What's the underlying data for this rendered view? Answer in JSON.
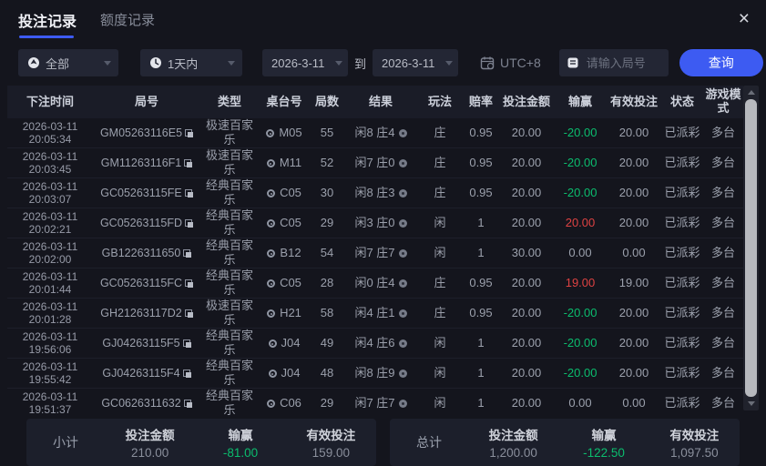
{
  "window": {
    "close_icon": "×"
  },
  "tabs": [
    {
      "label": "投注记录",
      "active": true
    },
    {
      "label": "额度记录",
      "active": false
    }
  ],
  "filters": {
    "category": {
      "value": "全部",
      "icon": "target-icon"
    },
    "range": {
      "value": "1天内",
      "icon": "clock-icon"
    },
    "date_from": "2026-3-11",
    "to_label": "到",
    "date_to": "2026-3-11",
    "timezone": "UTC+8",
    "timezone_icon": "calendar-icon",
    "search_placeholder": "请输入局号",
    "query_label": "查询"
  },
  "table": {
    "headers": [
      "下注时间",
      "局号",
      "类型",
      "桌台号",
      "局数",
      "结果",
      "玩法",
      "赔率",
      "投注金额",
      "输赢",
      "有效投注",
      "状态",
      "游戏模式"
    ],
    "rows": [
      {
        "date": "2026-03-11",
        "time": "20:05:34",
        "game_id": "GM05263116E5",
        "type": "极速百家乐",
        "table_no": "M05",
        "round": "55",
        "result": "闲8 庄4",
        "play": "庄",
        "odds": "0.95",
        "amount": "20.00",
        "win_loss": "-20.00",
        "win_loss_color": "green",
        "valid": "20.00",
        "status": "已派彩",
        "mode": "多台"
      },
      {
        "date": "2026-03-11",
        "time": "20:03:45",
        "game_id": "GM11263116F1",
        "type": "极速百家乐",
        "table_no": "M11",
        "round": "52",
        "result": "闲7 庄0",
        "play": "庄",
        "odds": "0.95",
        "amount": "20.00",
        "win_loss": "-20.00",
        "win_loss_color": "green",
        "valid": "20.00",
        "status": "已派彩",
        "mode": "多台"
      },
      {
        "date": "2026-03-11",
        "time": "20:03:07",
        "game_id": "GC05263115FE",
        "type": "经典百家乐",
        "table_no": "C05",
        "round": "30",
        "result": "闲8 庄3",
        "play": "庄",
        "odds": "0.95",
        "amount": "20.00",
        "win_loss": "-20.00",
        "win_loss_color": "green",
        "valid": "20.00",
        "status": "已派彩",
        "mode": "多台"
      },
      {
        "date": "2026-03-11",
        "time": "20:02:21",
        "game_id": "GC05263115FD",
        "type": "经典百家乐",
        "table_no": "C05",
        "round": "29",
        "result": "闲3 庄0",
        "play": "闲",
        "odds": "1",
        "amount": "20.00",
        "win_loss": "20.00",
        "win_loss_color": "red",
        "valid": "20.00",
        "status": "已派彩",
        "mode": "多台"
      },
      {
        "date": "2026-03-11",
        "time": "20:02:00",
        "game_id": "GB1226311650",
        "type": "经典百家乐",
        "table_no": "B12",
        "round": "54",
        "result": "闲7 庄7",
        "play": "闲",
        "odds": "1",
        "amount": "30.00",
        "win_loss": "0.00",
        "win_loss_color": "neutral",
        "valid": "0.00",
        "status": "已派彩",
        "mode": "多台"
      },
      {
        "date": "2026-03-11",
        "time": "20:01:44",
        "game_id": "GC05263115FC",
        "type": "经典百家乐",
        "table_no": "C05",
        "round": "28",
        "result": "闲0 庄4",
        "play": "庄",
        "odds": "0.95",
        "amount": "20.00",
        "win_loss": "19.00",
        "win_loss_color": "red",
        "valid": "19.00",
        "status": "已派彩",
        "mode": "多台"
      },
      {
        "date": "2026-03-11",
        "time": "20:01:28",
        "game_id": "GH21263117D2",
        "type": "极速百家乐",
        "table_no": "H21",
        "round": "58",
        "result": "闲4 庄1",
        "play": "庄",
        "odds": "0.95",
        "amount": "20.00",
        "win_loss": "-20.00",
        "win_loss_color": "green",
        "valid": "20.00",
        "status": "已派彩",
        "mode": "多台"
      },
      {
        "date": "2026-03-11",
        "time": "19:56:06",
        "game_id": "GJ04263115F5",
        "type": "经典百家乐",
        "table_no": "J04",
        "round": "49",
        "result": "闲4 庄6",
        "play": "闲",
        "odds": "1",
        "amount": "20.00",
        "win_loss": "-20.00",
        "win_loss_color": "green",
        "valid": "20.00",
        "status": "已派彩",
        "mode": "多台"
      },
      {
        "date": "2026-03-11",
        "time": "19:55:42",
        "game_id": "GJ04263115F4",
        "type": "经典百家乐",
        "table_no": "J04",
        "round": "48",
        "result": "闲8 庄9",
        "play": "闲",
        "odds": "1",
        "amount": "20.00",
        "win_loss": "-20.00",
        "win_loss_color": "green",
        "valid": "20.00",
        "status": "已派彩",
        "mode": "多台"
      },
      {
        "date": "2026-03-11",
        "time": "19:51:37",
        "game_id": "GC0626311632",
        "type": "经典百家乐",
        "table_no": "C06",
        "round": "29",
        "result": "闲7 庄7",
        "play": "闲",
        "odds": "1",
        "amount": "20.00",
        "win_loss": "0.00",
        "win_loss_color": "neutral",
        "valid": "0.00",
        "status": "已派彩",
        "mode": "多台"
      }
    ]
  },
  "summary": {
    "subtotal": {
      "label": "小计",
      "amount_label": "投注金额",
      "amount": "210.00",
      "win_loss_label": "输赢",
      "win_loss": "-81.00",
      "valid_label": "有效投注",
      "valid": "159.00"
    },
    "total": {
      "label": "总计",
      "amount_label": "投注金额",
      "amount": "1,200.00",
      "win_loss_label": "输赢",
      "win_loss": "-122.50",
      "valid_label": "有效投注",
      "valid": "1,097.50"
    }
  },
  "colors": {
    "accent_blue": "#3d5bf2",
    "win_green": "#0bbd6e",
    "loss_red": "#de4242",
    "background": "#14151d"
  }
}
